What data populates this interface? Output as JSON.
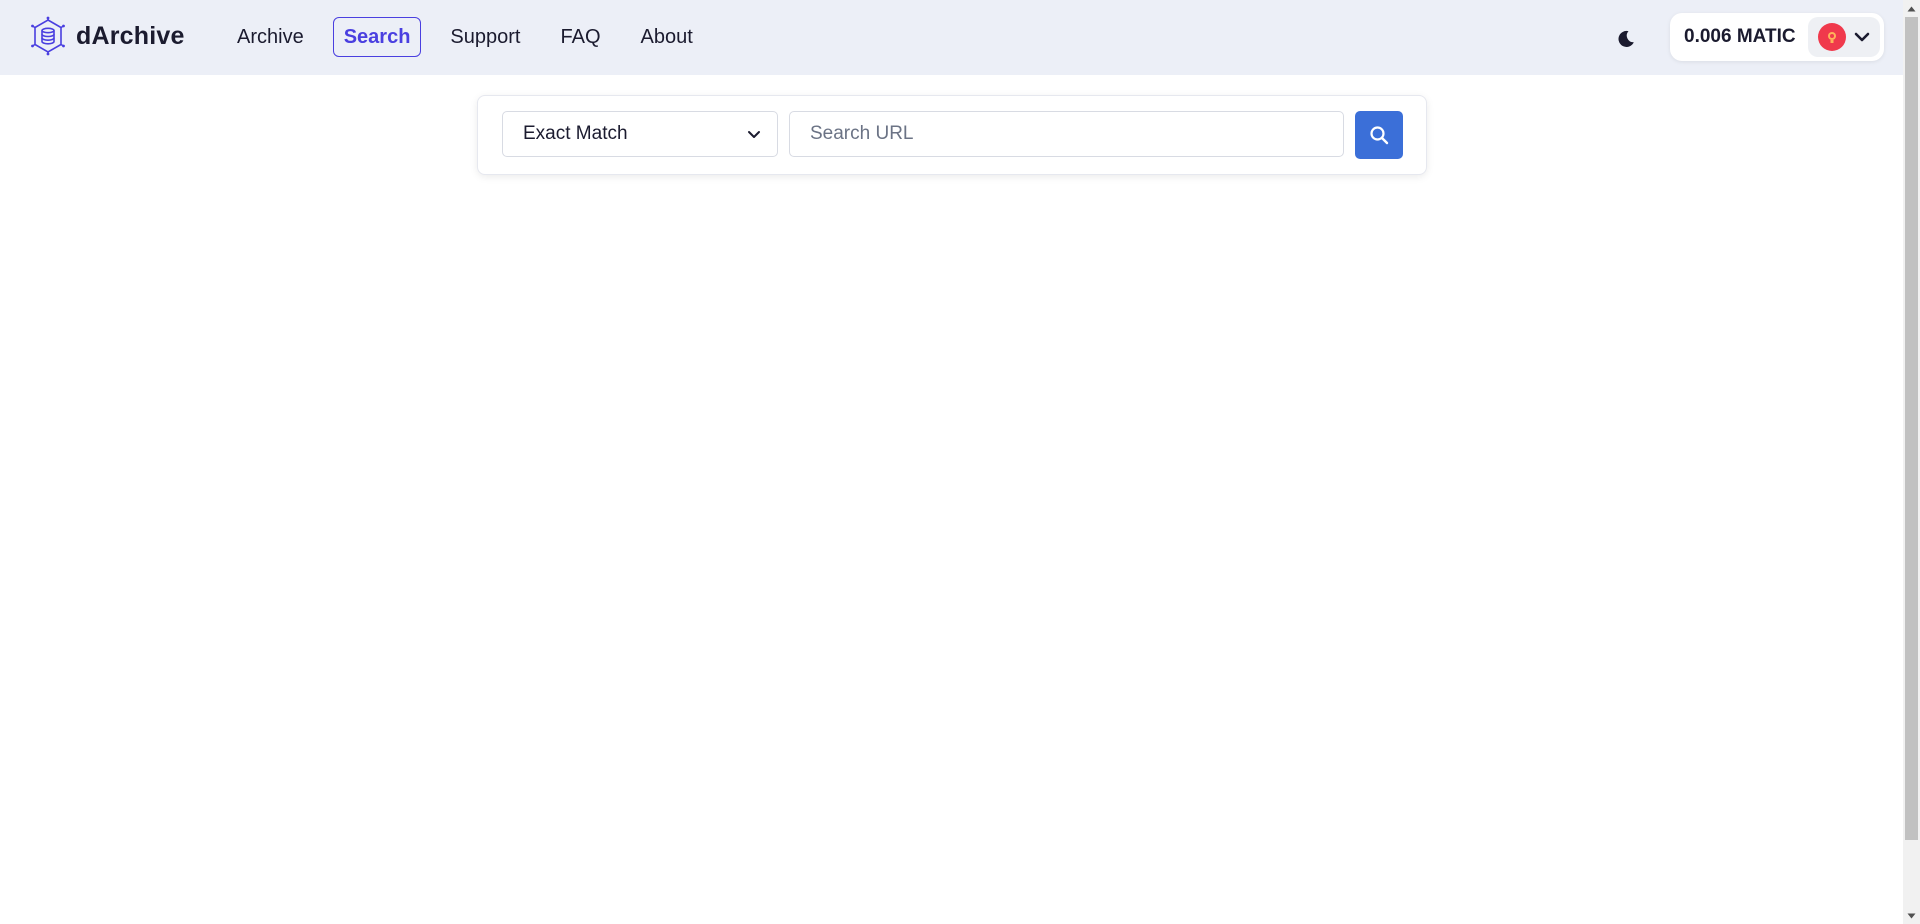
{
  "header": {
    "brand": "dArchive",
    "nav": [
      {
        "label": "Archive",
        "active": false
      },
      {
        "label": "Search",
        "active": true
      },
      {
        "label": "Support",
        "active": false
      },
      {
        "label": "FAQ",
        "active": false
      },
      {
        "label": "About",
        "active": false
      }
    ],
    "theme_icon": "moon-icon",
    "wallet": {
      "balance": "0.006 MATIC",
      "avatar_icon": "avatar-icon",
      "chevron_icon": "chevron-down-icon"
    }
  },
  "search": {
    "match_type": "Exact Match",
    "input_value": "",
    "input_placeholder": "Search URL",
    "button_icon": "search-icon"
  },
  "colors": {
    "accent": "#4a3fe0",
    "button": "#3b6fd8",
    "header_bg": "#eceff7",
    "avatar": "#f0394c"
  }
}
